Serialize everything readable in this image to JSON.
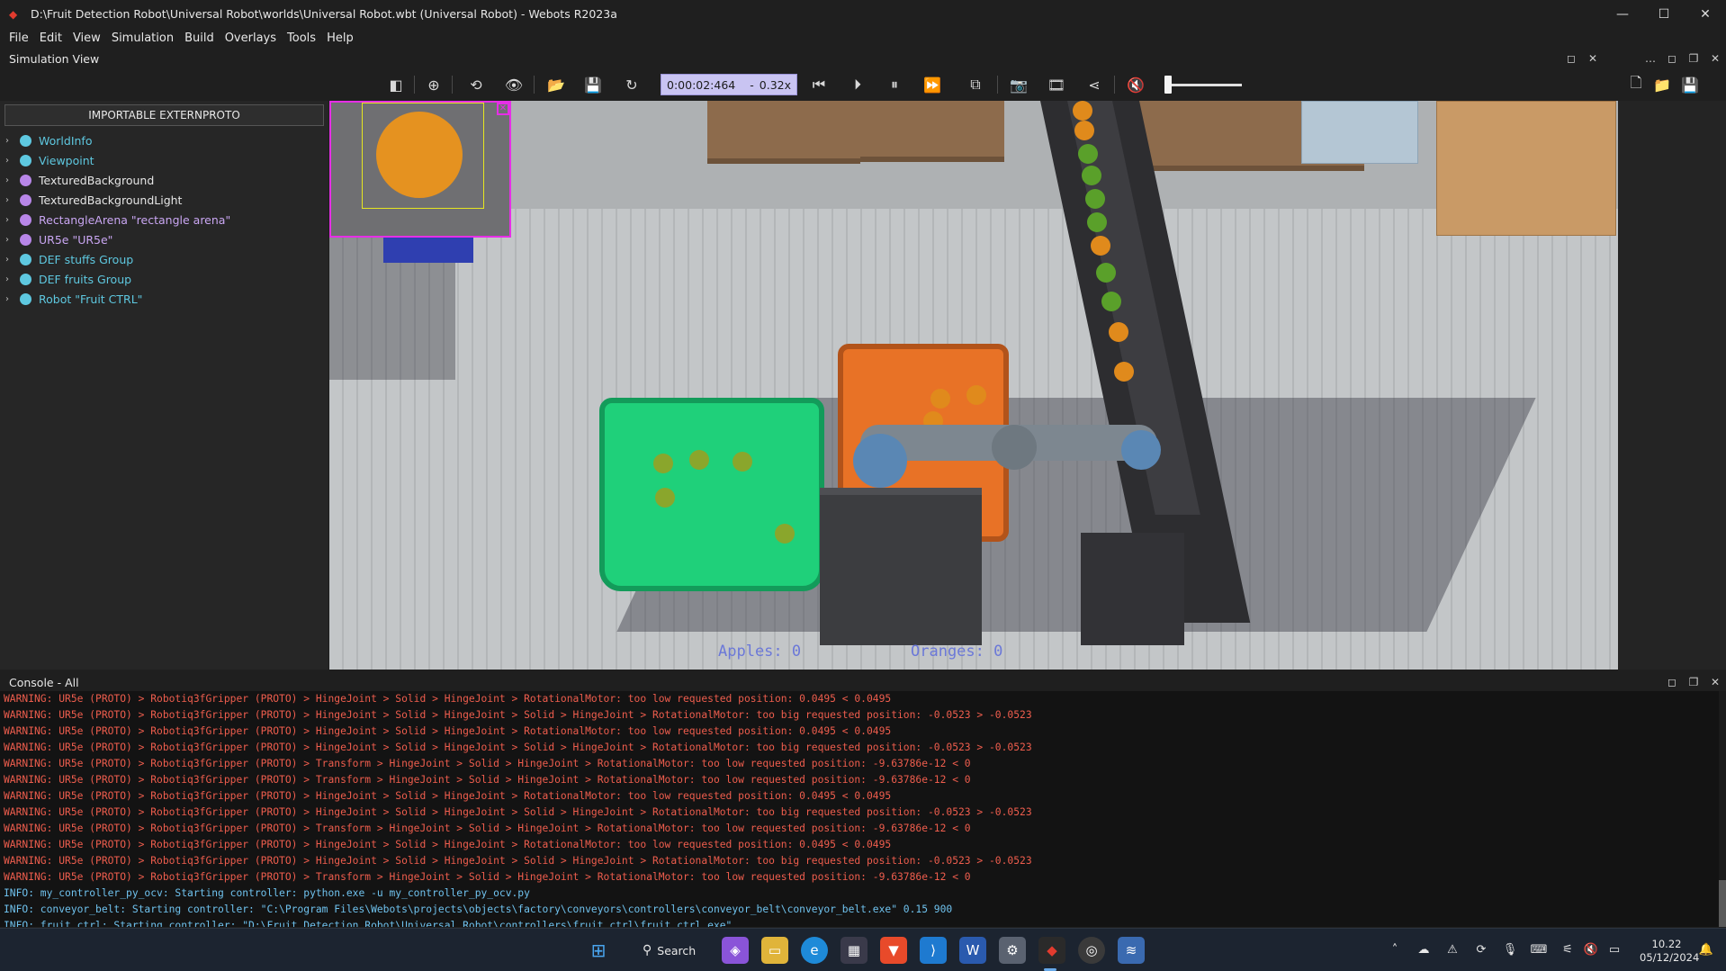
{
  "window": {
    "title": "D:\\Fruit Detection Robot\\Universal Robot\\worlds\\Universal Robot.wbt (Universal Robot) - Webots R2023a",
    "minimize": "—",
    "maximize": "☐",
    "close": "✕"
  },
  "menu": [
    {
      "label": "File"
    },
    {
      "label": "Edit"
    },
    {
      "label": "View"
    },
    {
      "label": "Simulation"
    },
    {
      "label": "Build"
    },
    {
      "label": "Overlays"
    },
    {
      "label": "Tools"
    },
    {
      "label": "Help"
    }
  ],
  "sim_view": {
    "label": "Simulation View"
  },
  "toolbar": {
    "time": "0:00:02:464",
    "time_dash": "-",
    "speed": "0.32x",
    "volume_level": 0.1
  },
  "scene_tree": {
    "import_button": "IMPORTABLE EXTERNPROTO",
    "items": [
      {
        "label": "WorldInfo",
        "color": "#5ec8e0"
      },
      {
        "label": "Viewpoint",
        "color": "#5ec8e0"
      },
      {
        "label": "TexturedBackground",
        "color": "#b886e8"
      },
      {
        "label": "TexturedBackgroundLight",
        "color": "#b886e8"
      },
      {
        "label": "RectangleArena \"rectangle arena\"",
        "color": "#b886e8"
      },
      {
        "label": "UR5e \"UR5e\"",
        "color": "#b886e8"
      },
      {
        "label": "DEF stuffs Group",
        "color": "#5ec8e0"
      },
      {
        "label": "DEF fruits Group",
        "color": "#5ec8e0"
      },
      {
        "label": "Robot \"Fruit CTRL\"",
        "color": "#5ec8e0"
      }
    ]
  },
  "viewport": {
    "apples_label": "Apples: 0",
    "oranges_label": "Oranges: 0"
  },
  "console": {
    "label": "Console - All",
    "lines": [
      {
        "type": "warn",
        "text": "WARNING: UR5e (PROTO) > Robotiq3fGripper (PROTO) > HingeJoint > Solid > HingeJoint > RotationalMotor: too low requested position: 0.0495 < 0.0495"
      },
      {
        "type": "warn",
        "text": "WARNING: UR5e (PROTO) > Robotiq3fGripper (PROTO) > HingeJoint > Solid > HingeJoint > Solid > HingeJoint > RotationalMotor: too big requested position: -0.0523 > -0.0523"
      },
      {
        "type": "warn",
        "text": "WARNING: UR5e (PROTO) > Robotiq3fGripper (PROTO) > HingeJoint > Solid > HingeJoint > RotationalMotor: too low requested position: 0.0495 < 0.0495"
      },
      {
        "type": "warn",
        "text": "WARNING: UR5e (PROTO) > Robotiq3fGripper (PROTO) > HingeJoint > Solid > HingeJoint > Solid > HingeJoint > RotationalMotor: too big requested position: -0.0523 > -0.0523"
      },
      {
        "type": "warn",
        "text": "WARNING: UR5e (PROTO) > Robotiq3fGripper (PROTO) > Transform > HingeJoint > Solid > HingeJoint > RotationalMotor: too low requested position: -9.63786e-12 < 0"
      },
      {
        "type": "warn",
        "text": "WARNING: UR5e (PROTO) > Robotiq3fGripper (PROTO) > Transform > HingeJoint > Solid > HingeJoint > RotationalMotor: too low requested position: -9.63786e-12 < 0"
      },
      {
        "type": "warn",
        "text": "WARNING: UR5e (PROTO) > Robotiq3fGripper (PROTO) > HingeJoint > Solid > HingeJoint > RotationalMotor: too low requested position: 0.0495 < 0.0495"
      },
      {
        "type": "warn",
        "text": "WARNING: UR5e (PROTO) > Robotiq3fGripper (PROTO) > HingeJoint > Solid > HingeJoint > Solid > HingeJoint > RotationalMotor: too big requested position: -0.0523 > -0.0523"
      },
      {
        "type": "warn",
        "text": "WARNING: UR5e (PROTO) > Robotiq3fGripper (PROTO) > Transform > HingeJoint > Solid > HingeJoint > RotationalMotor: too low requested position: -9.63786e-12 < 0"
      },
      {
        "type": "warn",
        "text": "WARNING: UR5e (PROTO) > Robotiq3fGripper (PROTO) > HingeJoint > Solid > HingeJoint > RotationalMotor: too low requested position: 0.0495 < 0.0495"
      },
      {
        "type": "warn",
        "text": "WARNING: UR5e (PROTO) > Robotiq3fGripper (PROTO) > HingeJoint > Solid > HingeJoint > Solid > HingeJoint > RotationalMotor: too big requested position: -0.0523 > -0.0523"
      },
      {
        "type": "warn",
        "text": "WARNING: UR5e (PROTO) > Robotiq3fGripper (PROTO) > Transform > HingeJoint > Solid > HingeJoint > RotationalMotor: too low requested position: -9.63786e-12 < 0"
      },
      {
        "type": "info",
        "text": "INFO: my_controller_py_ocv: Starting controller: python.exe -u my_controller_py_ocv.py"
      },
      {
        "type": "info",
        "text": "INFO: conveyor_belt: Starting controller: \"C:\\Program Files\\Webots\\projects\\objects\\factory\\conveyors\\controllers\\conveyor_belt\\conveyor_belt.exe\" 0.15 900"
      },
      {
        "type": "info",
        "text": "INFO: fruit_ctrl: Starting controller: \"D:\\Fruit Detection Robot\\Universal Robot\\controllers\\fruit_ctrl\\fruit_ctrl.exe\""
      }
    ]
  },
  "taskbar": {
    "search_label": "Search",
    "time": "10.22",
    "date": "05/12/2024"
  }
}
